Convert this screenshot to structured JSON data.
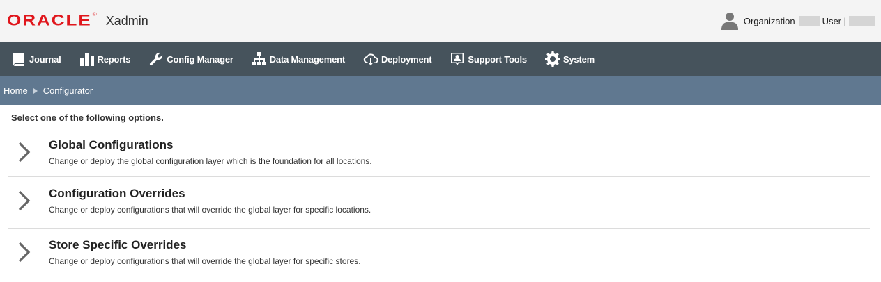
{
  "header": {
    "logo_text": "ORACLE",
    "logo_mark": "®",
    "app_name": "Xadmin",
    "organization_label": "Organization",
    "user_label": "User |"
  },
  "nav": {
    "items": [
      {
        "label": "Journal",
        "icon": "book-icon"
      },
      {
        "label": "Reports",
        "icon": "bar-chart-icon"
      },
      {
        "label": "Config Manager",
        "icon": "wrench-icon"
      },
      {
        "label": "Data Management",
        "icon": "hierarchy-icon"
      },
      {
        "label": "Deployment",
        "icon": "cloud-download-icon"
      },
      {
        "label": "Support Tools",
        "icon": "support-icon"
      },
      {
        "label": "System",
        "icon": "gear-icon"
      }
    ]
  },
  "breadcrumb": {
    "items": [
      "Home",
      "Configurator"
    ]
  },
  "main": {
    "intro": "Select one of the following options.",
    "options": [
      {
        "title": "Global Configurations",
        "description": "Change or deploy the global configuration layer which is the foundation for all locations."
      },
      {
        "title": "Configuration Overrides",
        "description": "Change or deploy configurations that will override the global layer for specific locations."
      },
      {
        "title": "Store Specific Overrides",
        "description": "Change or deploy configurations that will override the global layer for specific stores."
      }
    ]
  },
  "colors": {
    "brand_red": "#e0161c",
    "navbar": "#46535c",
    "breadcrumb_bar": "#607890"
  }
}
